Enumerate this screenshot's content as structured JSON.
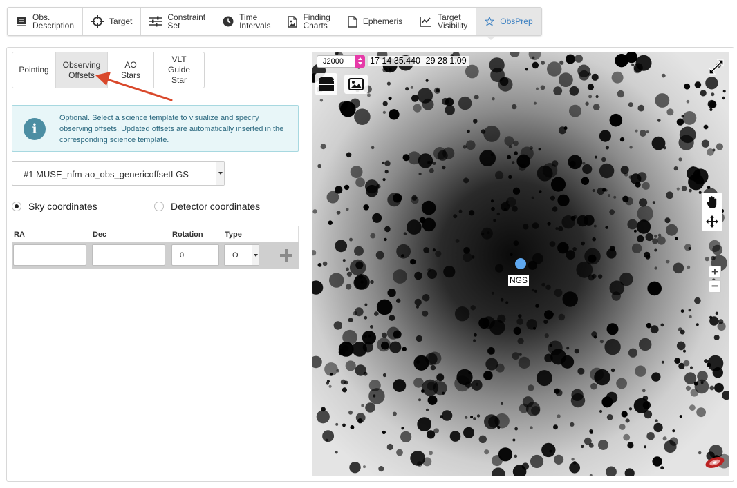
{
  "toolbar": {
    "items": [
      {
        "label": "Obs.\nDescription",
        "icon": "book-icon"
      },
      {
        "label": "Target",
        "icon": "crosshair-icon"
      },
      {
        "label": "Constraint\nSet",
        "icon": "sliders-icon"
      },
      {
        "label": "Time\nIntervals",
        "icon": "clock-icon"
      },
      {
        "label": "Finding\nCharts",
        "icon": "file-chart-icon"
      },
      {
        "label": "Ephemeris",
        "icon": "file-icon"
      },
      {
        "label": "Target\nVisibility",
        "icon": "line-chart-icon"
      },
      {
        "label": "ObsPrep",
        "icon": "star-icon",
        "active": true
      }
    ],
    "active_color": "#3a7fc1"
  },
  "subtabs": [
    {
      "label": "Pointing"
    },
    {
      "label": "Observing\nOffsets",
      "active": true
    },
    {
      "label": "AO Stars"
    },
    {
      "label": "VLT Guide\nStar"
    }
  ],
  "info": {
    "icon": "info-icon",
    "text": "Optional. Select a science template to visualize and specify observing offsets. Updated offsets are automatically inserted in the corresponding science template."
  },
  "template_select": {
    "value": "#1 MUSE_nfm-ao_obs_genericoffsetLGS"
  },
  "coordinate_mode": {
    "options": [
      {
        "label": "Sky coordinates",
        "checked": true
      },
      {
        "label": "Detector coordinates",
        "checked": false
      }
    ]
  },
  "offsets": {
    "headers": [
      "RA",
      "Dec",
      "Rotation",
      "Type"
    ],
    "row": {
      "ra": "",
      "dec": "",
      "rotation": "0",
      "type": "O"
    }
  },
  "viewer": {
    "frame": "J2000",
    "coords": "17 14 35.440 -29 28 1.09",
    "marker_label": "NGS",
    "marker_color": "#5ea8f0",
    "zoom_in": "+",
    "zoom_out": "−"
  },
  "annotation": {
    "color": "#d9482b"
  }
}
